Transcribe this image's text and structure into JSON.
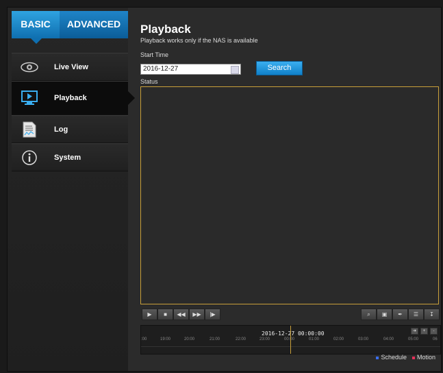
{
  "tabs": {
    "basic": "BASIC",
    "advanced": "ADVANCED"
  },
  "menu": [
    {
      "label": "Live View",
      "icon": "eye-icon"
    },
    {
      "label": "Playback",
      "icon": "monitor-play-icon"
    },
    {
      "label": "Log",
      "icon": "document-icon"
    },
    {
      "label": "System",
      "icon": "info-icon"
    }
  ],
  "page": {
    "title": "Playback",
    "subtitle": "Playback works only if the NAS is available",
    "start_time_label": "Start Time",
    "start_time_value": "2016-12-27",
    "search_label": "Search",
    "status_label": "Status"
  },
  "timeline": {
    "date": "2016-12-27 00:00:00",
    "hours": [
      ":00",
      "19:00",
      "20:00",
      "21:00",
      "22:00",
      "23:00",
      "00:00",
      "01:00",
      "02:00",
      "03:00",
      "04:00",
      "05:00",
      "06"
    ]
  },
  "legend": {
    "schedule": "Schedule",
    "motion": "Motion",
    "schedule_color": "#3a6ff0",
    "motion_color": "#e8305a"
  }
}
